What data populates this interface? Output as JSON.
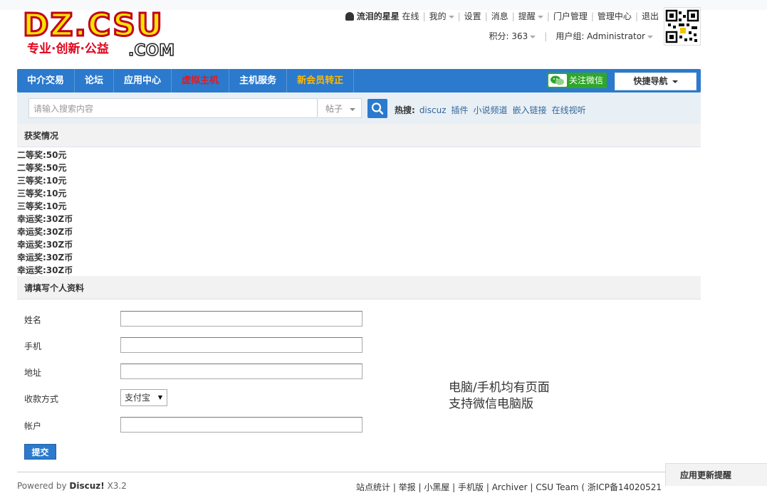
{
  "header": {
    "logo_text": "DZ.CSU",
    "logo_sub": "专业·创新·公益.COM",
    "username": "流泪的星星",
    "online": "在线",
    "links": [
      "我的",
      "设置",
      "消息",
      "提醒",
      "门户管理",
      "管理中心",
      "退出"
    ],
    "points_label": "积分: 363",
    "usergroup_label": "用户组: Administrator"
  },
  "nav": {
    "items": [
      "中介交易",
      "论坛",
      "应用中心",
      "虚拟主机",
      "主机服务",
      "新会员转正"
    ],
    "wechat_label": "关注微信",
    "quick_nav_label": "快捷导航"
  },
  "search": {
    "placeholder": "请输入搜索内容",
    "type_label": "帖子",
    "hot_label": "热搜:",
    "hot_links": [
      "discuz",
      "插件",
      "小说频道",
      "嵌入链接",
      "在线视听"
    ]
  },
  "awards": {
    "title": "获奖情况",
    "items": [
      "二等奖:50元",
      "二等奖:50元",
      "三等奖:10元",
      "三等奖:10元",
      "三等奖:10元",
      "幸运奖:30Z币",
      "幸运奖:30Z币",
      "幸运奖:30Z币",
      "幸运奖:30Z币",
      "幸运奖:30Z币"
    ]
  },
  "profile": {
    "title": "请填写个人资料",
    "name_label": "姓名",
    "phone_label": "手机",
    "address_label": "地址",
    "payment_label": "收款方式",
    "payment_value": "支付宝",
    "account_label": "帐户",
    "submit_label": "提交",
    "note_line1": "电脑/手机均有页面",
    "note_line2": "支持微信电脑版"
  },
  "footer": {
    "powered_prefix": "Powered by",
    "powered_brand": "Discuz!",
    "powered_version": "X3.2",
    "links_text": "站点统计 | 举报 | 小黑屋 | 手机版 | Archiver | CSU Team ( 浙ICP备14020521",
    "update_tip": "应用更新提醒"
  },
  "colors": {
    "nav_blue": "#2b7acd",
    "wechat_green": "#2fa62a",
    "nav_red": "#e8181a",
    "nav_orange": "#ffb800"
  }
}
